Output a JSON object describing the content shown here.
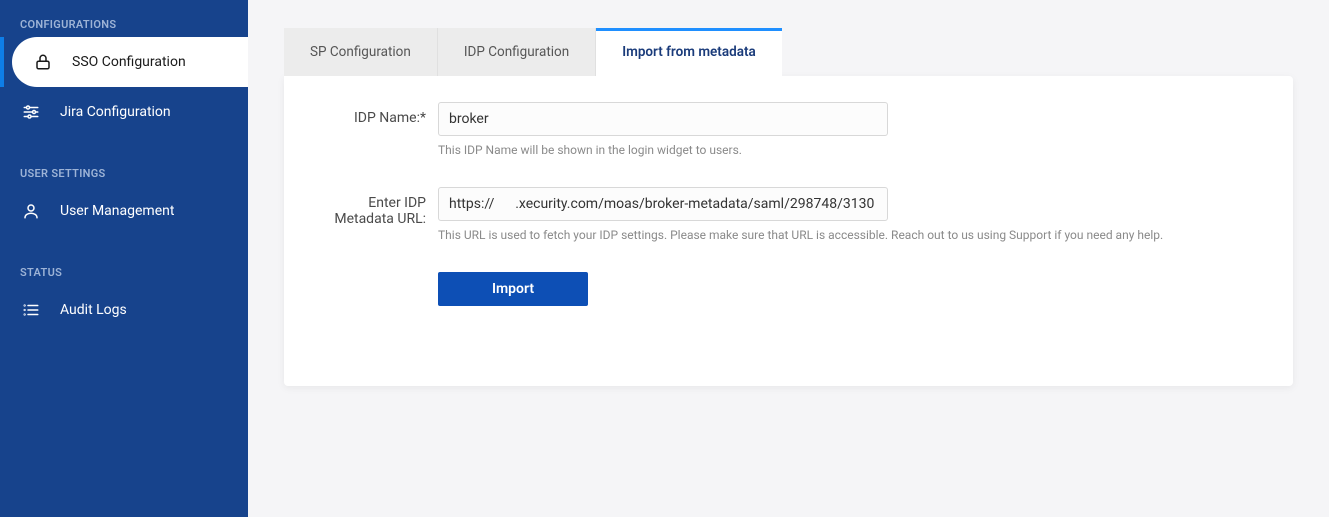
{
  "sidebar": {
    "sections": {
      "configurations": {
        "label": "CONFIGURATIONS",
        "items": [
          {
            "label": "SSO Configuration"
          },
          {
            "label": "Jira Configuration"
          }
        ]
      },
      "user_settings": {
        "label": "USER SETTINGS",
        "items": [
          {
            "label": "User Management"
          }
        ]
      },
      "status": {
        "label": "STATUS",
        "items": [
          {
            "label": "Audit Logs"
          }
        ]
      }
    }
  },
  "tabs": {
    "sp": "SP Configuration",
    "idp": "IDP Configuration",
    "import": "Import from metadata"
  },
  "form": {
    "idp_name": {
      "label": "IDP Name:*",
      "value": "broker",
      "help": "This IDP Name will be shown in the login widget to users."
    },
    "metadata_url": {
      "label": "Enter IDP Metadata URL:",
      "value": "https://      .xecurity.com/moas/broker-metadata/saml/298748/3130",
      "help": "This URL is used to fetch your IDP settings. Please make sure that URL is accessible. Reach out to us using Support if you need any help."
    },
    "import_button": "Import"
  }
}
